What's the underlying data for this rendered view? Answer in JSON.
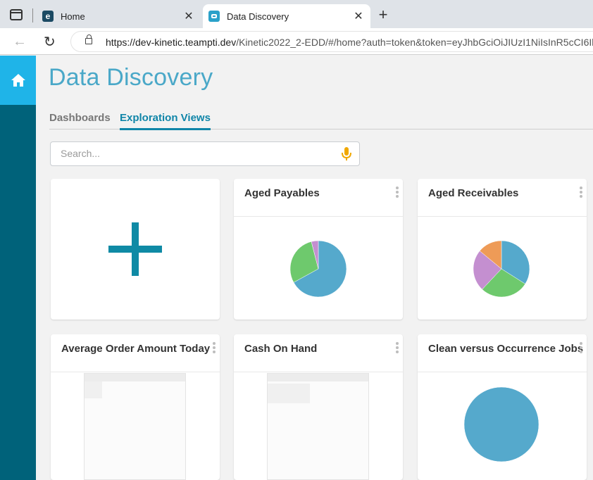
{
  "browser": {
    "tabs": [
      {
        "label": "Home",
        "favicon": "e"
      },
      {
        "label": "Data Discovery"
      }
    ],
    "url_host": "https://dev-kinetic.teampti.dev",
    "url_path": "/Kinetic2022_2-EDD/#/home?auth=token&token=eyJhbGciOiJIUzI1NiIsInR5cCI6Ik"
  },
  "app": {
    "title": "Data Discovery",
    "tabs": [
      {
        "label": "Dashboards",
        "active": false
      },
      {
        "label": "Exploration Views",
        "active": true
      }
    ],
    "search": {
      "placeholder": "Search...",
      "value": ""
    },
    "colors": {
      "accent": "#0f85a8",
      "sidebar": "#00627a",
      "home_button": "#1fb4e8",
      "title": "#4aa8c8",
      "mic": "#f0a800"
    }
  },
  "cards": [
    {
      "title": "",
      "kind": "add",
      "icon": "plus-icon"
    },
    {
      "title": "Aged Payables",
      "kind": "pie"
    },
    {
      "title": "Aged Receivables",
      "kind": "pie"
    },
    {
      "title": "Average Order Amount Today",
      "kind": "table"
    },
    {
      "title": "Cash On Hand",
      "kind": "table"
    },
    {
      "title": "Clean versus Occurrence Jobs",
      "kind": "pie"
    }
  ],
  "chart_data": [
    {
      "type": "pie",
      "slices": [
        {
          "value": 0.67,
          "color": "#55a9cc"
        },
        {
          "value": 0.29,
          "color": "#6ec96d"
        },
        {
          "value": 0.04,
          "color": "#c48fd0"
        }
      ]
    },
    {
      "type": "pie",
      "slices": [
        {
          "value": 0.34,
          "color": "#55a9cc"
        },
        {
          "value": 0.28,
          "color": "#6ec96d"
        },
        {
          "value": 0.24,
          "color": "#c48fd0"
        },
        {
          "value": 0.14,
          "color": "#ee9b57"
        }
      ]
    },
    {
      "type": "pie",
      "slices": [
        {
          "value": 1.0,
          "color": "#55a9cc"
        }
      ]
    }
  ]
}
